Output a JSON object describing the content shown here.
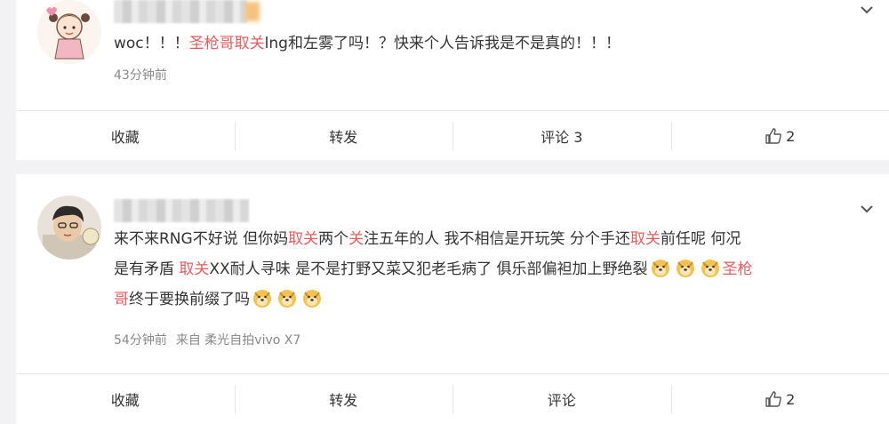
{
  "posts": [
    {
      "text_parts": [
        {
          "t": "woc！！！",
          "hl": false
        },
        {
          "t": "圣枪哥取关",
          "hl": true
        },
        {
          "t": "lng和左雾了吗！？快来个人告诉我是不是真的！！！",
          "hl": false
        }
      ],
      "time": "43分钟前",
      "source": "",
      "actions": {
        "favorite": "收藏",
        "repost": "转发",
        "comment": "评论 3",
        "like_count": "2"
      }
    },
    {
      "line1": [
        {
          "t": "来不来RNG不好说 但你妈",
          "hl": false
        },
        {
          "t": "取关",
          "hl": true
        },
        {
          "t": "两个",
          "hl": false
        },
        {
          "t": "关",
          "hl": true
        },
        {
          "t": "注五年的人 我不相信是开玩笑 分个手还",
          "hl": false
        },
        {
          "t": "取关",
          "hl": true
        },
        {
          "t": "前任呢 何况",
          "hl": false
        }
      ],
      "line2_a": "是有矛盾 ",
      "line2_hl": "取关",
      "line2_b": "XX耐人寻味 是不是打野又菜又犯老毛病了 俱乐部偏袒加上野绝裂",
      "line2_tail": "圣枪",
      "line3_hl": "哥",
      "line3": "终于要换前缀了吗",
      "time": "54分钟前",
      "source": "来自 柔光自拍vivo X7",
      "actions": {
        "favorite": "收藏",
        "repost": "转发",
        "comment": "评论",
        "like_count": "2"
      }
    }
  ],
  "icons": {
    "chevron": "chevron-down-icon",
    "like": "thumbs-up-icon",
    "emoji": "doge-emoji-icon"
  },
  "colors": {
    "highlight": "#eb5b5b",
    "meta": "#888888",
    "background": "#f2f2f5"
  }
}
